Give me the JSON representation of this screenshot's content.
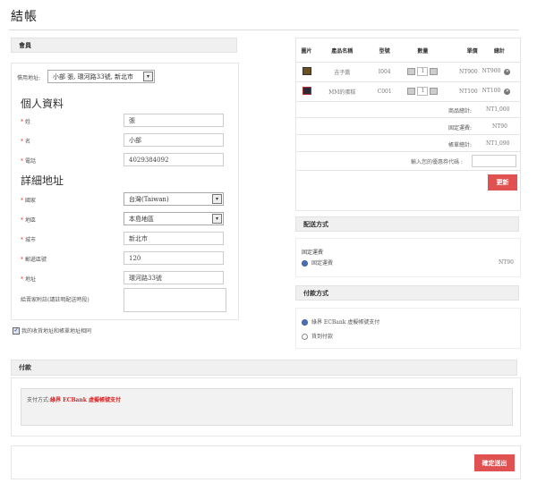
{
  "page": {
    "title": "結帳"
  },
  "member": {
    "header": "會員",
    "common_address_label": "慣用地址:",
    "common_address_value": "小部 張, 環河路33號, 新北市",
    "personal_title": "個人資料",
    "last_name_label": "姓",
    "last_name_value": "張",
    "first_name_label": "名",
    "first_name_value": "小部",
    "phone_label": "電話",
    "phone_value": "4029384092",
    "address_title": "詳細地址",
    "country_label": "國家",
    "country_value": "台灣(Taiwan)",
    "region_label": "地區",
    "region_value": "本島地區",
    "city_label": "城市",
    "city_value": "新北市",
    "postal_label": "郵遞區號",
    "postal_value": "120",
    "address_label": "地址",
    "address_value": "環河路33號",
    "note_label": "給賣家附註(請註明配送時段)",
    "same_address_label": "我的收貨地址和帳單地址相同"
  },
  "cart": {
    "columns": [
      "圖片",
      "產品名稱",
      "型號",
      "數量",
      "單價",
      "總計"
    ],
    "rows": [
      {
        "name": "吉子醬",
        "model": "I004",
        "qty": "1",
        "price": "NT900",
        "total": "NT900"
      },
      {
        "name": "MM的蛋糕",
        "model": "C001",
        "qty": "1",
        "price": "NT100",
        "total": "NT100"
      }
    ],
    "subtotal_label": "商品總計:",
    "subtotal_value": "NT1,000",
    "shipping_label": "固定運費:",
    "shipping_value": "NT90",
    "grand_label": "帳單總計:",
    "grand_value": "NT1,090",
    "coupon_label": "輸入您的優惠券代碼 :",
    "update_button": "更新"
  },
  "shipping": {
    "header": "配送方式",
    "group": "固定運費",
    "option": "固定運費",
    "price": "NT90"
  },
  "payment_method": {
    "header": "付款方式",
    "option1": "綠界 ECBank 虛擬帳號支付",
    "option2": "貨到付款"
  },
  "payment": {
    "header": "付款",
    "method_label": "支付方式:",
    "method_value": "綠界 ECBank 虛擬帳號支付"
  },
  "confirm_button": "確定送出",
  "colors": {
    "accent": "#e05252",
    "link_red": "#d22222"
  }
}
